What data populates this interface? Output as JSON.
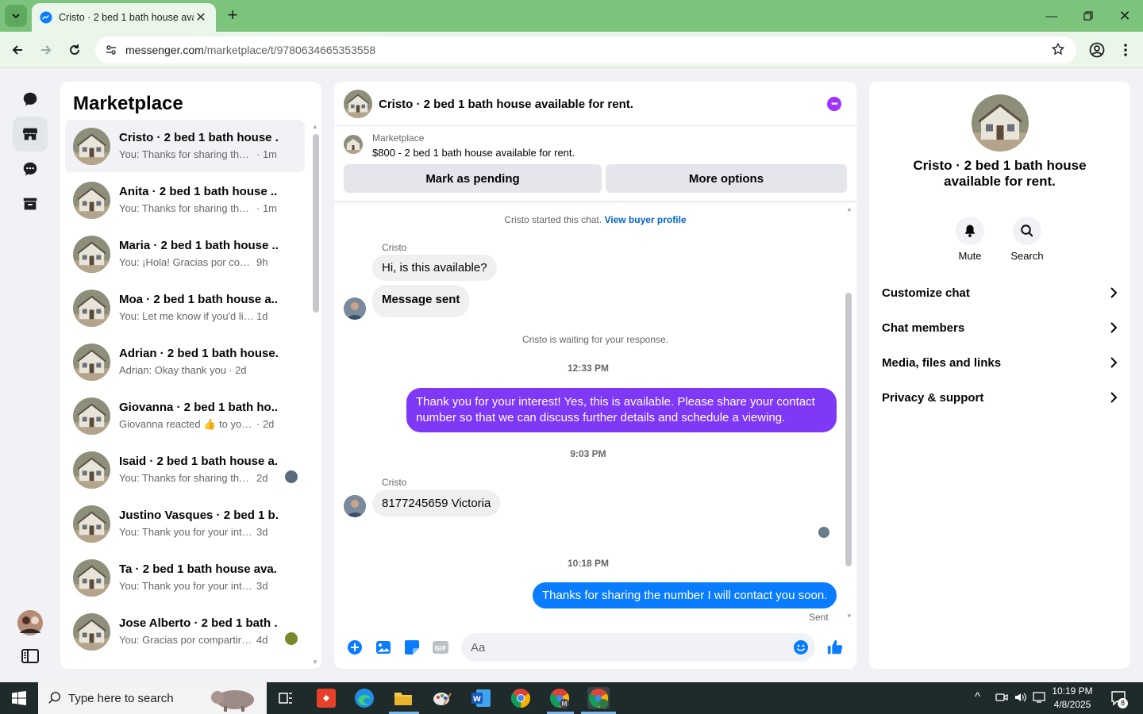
{
  "browser": {
    "tab_title": "Cristo · 2 bed 1 bath house avai",
    "url_host": "messenger.com",
    "url_path": "/marketplace/t/9780634665353558"
  },
  "list": {
    "title": "Marketplace",
    "conversations": [
      {
        "name": "Cristo · 2 bed 1 bath house ...",
        "preview": "You: Thanks for sharing the ...",
        "time": "· 1m"
      },
      {
        "name": "Anita · 2 bed 1 bath house ...",
        "preview": "You: Thanks for sharing the ...",
        "time": "· 1m"
      },
      {
        "name": "Maria · 2 bed 1 bath house ...",
        "preview": "You: ¡Hola! Gracias por conta...",
        "time": "9h"
      },
      {
        "name": "Moa · 2 bed 1 bath house a...",
        "preview": "You: Let me know if you'd lik...",
        "time": "1d"
      },
      {
        "name": "Adrian · 2 bed 1 bath house...",
        "preview": "Adrian: Okay thank you",
        "time": "· 2d"
      },
      {
        "name": "Giovanna · 2 bed 1 bath ho...",
        "preview": "Giovanna reacted 👍 to your...",
        "time": "· 2d"
      },
      {
        "name": "Isaid · 2 bed 1 bath house a...",
        "preview": "You: Thanks for sharing the n...",
        "time": "2d"
      },
      {
        "name": "Justino Vasques · 2 bed 1 b...",
        "preview": "You: Thank you for your inter...",
        "time": "3d"
      },
      {
        "name": "Ta · 2 bed 1 bath house ava...",
        "preview": "You: Thank you for your inter...",
        "time": "3d"
      },
      {
        "name": "Jose Alberto · 2 bed 1 bath ...",
        "preview": "You: Gracias por compartir el ...",
        "time": "4d"
      }
    ]
  },
  "chat": {
    "title": "Cristo · 2 bed 1 bath house available for rent.",
    "marketplace_label": "Marketplace",
    "listing": "$800 - 2 bed 1 bath house available for rent.",
    "mark_pending": "Mark as pending",
    "more_options": "More options",
    "started": "Cristo started this chat.",
    "view_profile": "View buyer profile",
    "sender1": "Cristo",
    "msg1": "Hi, is this available?",
    "msg2": "Message sent",
    "waiting": "Cristo is waiting for your response.",
    "ts1": "12:33 PM",
    "msg3": "Thank you for your interest! Yes, this is available. Please share your contact number so that we can discuss further details and schedule a viewing.",
    "ts2": "9:03 PM",
    "sender2": "Cristo",
    "msg4": "8177245659 Victoria",
    "ts3": "10:18 PM",
    "msg5": "Thanks for sharing the number I will contact you soon.",
    "sent": "Sent",
    "input_placeholder": "Aa"
  },
  "info": {
    "name": "Cristo · 2 bed 1 bath house available for rent.",
    "mute": "Mute",
    "search": "Search",
    "rows": [
      "Customize chat",
      "Chat members",
      "Media, files and links",
      "Privacy & support"
    ]
  },
  "taskbar": {
    "search_placeholder": "Type here to search",
    "time": "10:19 PM",
    "date": "4/8/2025",
    "notif_count": "8"
  },
  "colors": {
    "accent_purple": "#7f38f5",
    "accent_blue": "#0a7cff",
    "chrome_green": "#7cc47c"
  }
}
